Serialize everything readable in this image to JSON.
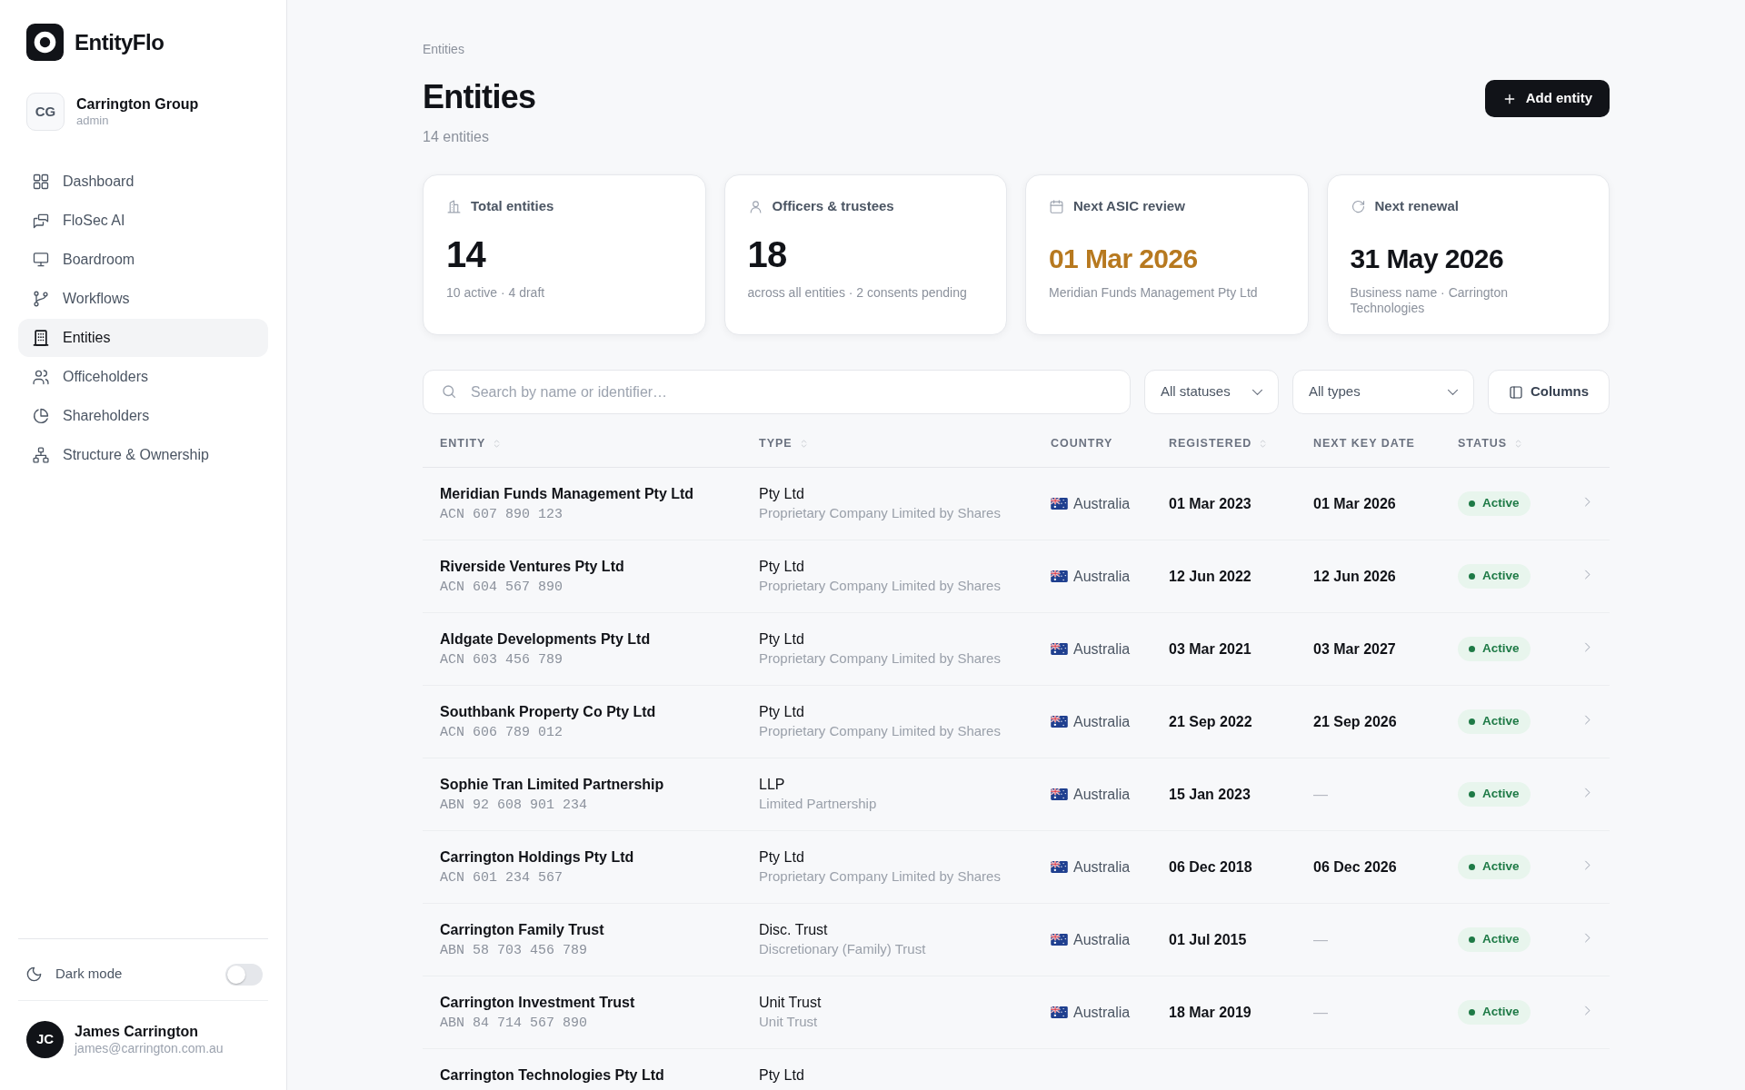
{
  "sidebar": {
    "brand": "EntityFlo",
    "organization": {
      "initials": "CG",
      "name": "Carrington Group",
      "role": "admin"
    },
    "nav": [
      {
        "label": "Dashboard",
        "selected": false
      },
      {
        "label": "FloSec AI",
        "selected": false
      },
      {
        "label": "Boardroom",
        "selected": false
      },
      {
        "label": "Workflows",
        "selected": false
      },
      {
        "label": "Entities",
        "selected": true
      },
      {
        "label": "Officeholders",
        "selected": false
      },
      {
        "label": "Shareholders",
        "selected": false
      },
      {
        "label": "Structure & Ownership",
        "selected": false
      }
    ],
    "dark_mode": {
      "label": "Dark mode",
      "on": false
    },
    "user": {
      "initials": "JC",
      "name": "James Carrington",
      "email": "james@carrington.com.au"
    }
  },
  "page": {
    "breadcrumb": "Entities",
    "title": "Entities",
    "subtitle": "14 entities",
    "add_button": "Add entity"
  },
  "stats": [
    {
      "label": "Total entities",
      "kind": "count",
      "value": "14",
      "warning": false,
      "note": "10 active · 4 draft"
    },
    {
      "label": "Officers & trustees",
      "kind": "count",
      "value": "18",
      "warning": false,
      "note": "across all entities · 2 consents pending"
    },
    {
      "label": "Next ASIC review",
      "kind": "date",
      "value": "01 Mar 2026",
      "warning": true,
      "note": "Meridian Funds Management Pty Ltd"
    },
    {
      "label": "Next renewal",
      "kind": "date",
      "value": "31 May 2026",
      "warning": false,
      "note": "Business name · Carrington Technologies"
    }
  ],
  "filters": {
    "search": {
      "placeholder": "Search by name or identifier…"
    },
    "status": "All statuses",
    "type": "All types",
    "columns_button": "Columns"
  },
  "table": {
    "columns": [
      {
        "label": "ENTITY",
        "sortable": true
      },
      {
        "label": "TYPE",
        "sortable": true
      },
      {
        "label": "COUNTRY",
        "sortable": false
      },
      {
        "label": "REGISTERED",
        "sortable": true
      },
      {
        "label": "NEXT KEY DATE",
        "sortable": false
      },
      {
        "label": "STATUS",
        "sortable": true
      }
    ],
    "rows": [
      {
        "name": "Meridian Funds Management Pty Ltd",
        "identifier": "ACN 607 890 123",
        "type": "Pty Ltd",
        "type_detail": "Proprietary Company Limited by Shares",
        "country": "Australia",
        "registered": "01 Mar 2023",
        "next_key_date": {
          "text": "01 Mar 2026",
          "muted": false
        },
        "status": "Active"
      },
      {
        "name": "Riverside Ventures Pty Ltd",
        "identifier": "ACN 604 567 890",
        "type": "Pty Ltd",
        "type_detail": "Proprietary Company Limited by Shares",
        "country": "Australia",
        "registered": "12 Jun 2022",
        "next_key_date": {
          "text": "12 Jun 2026",
          "muted": false
        },
        "status": "Active"
      },
      {
        "name": "Aldgate Developments Pty Ltd",
        "identifier": "ACN 603 456 789",
        "type": "Pty Ltd",
        "type_detail": "Proprietary Company Limited by Shares",
        "country": "Australia",
        "registered": "03 Mar 2021",
        "next_key_date": {
          "text": "03 Mar 2027",
          "muted": false
        },
        "status": "Active"
      },
      {
        "name": "Southbank Property Co Pty Ltd",
        "identifier": "ACN 606 789 012",
        "type": "Pty Ltd",
        "type_detail": "Proprietary Company Limited by Shares",
        "country": "Australia",
        "registered": "21 Sep 2022",
        "next_key_date": {
          "text": "21 Sep 2026",
          "muted": false
        },
        "status": "Active"
      },
      {
        "name": "Sophie Tran Limited Partnership",
        "identifier": "ABN 92 608 901 234",
        "type": "LLP",
        "type_detail": "Limited Partnership",
        "country": "Australia",
        "registered": "15 Jan 2023",
        "next_key_date": {
          "text": "—",
          "muted": true
        },
        "status": "Active"
      },
      {
        "name": "Carrington Holdings Pty Ltd",
        "identifier": "ACN 601 234 567",
        "type": "Pty Ltd",
        "type_detail": "Proprietary Company Limited by Shares",
        "country": "Australia",
        "registered": "06 Dec 2018",
        "next_key_date": {
          "text": "06 Dec 2026",
          "muted": false
        },
        "status": "Active"
      },
      {
        "name": "Carrington Family Trust",
        "identifier": "ABN 58 703 456 789",
        "type": "Disc. Trust",
        "type_detail": "Discretionary (Family) Trust",
        "country": "Australia",
        "registered": "01 Jul 2015",
        "next_key_date": {
          "text": "—",
          "muted": true
        },
        "status": "Active"
      },
      {
        "name": "Carrington Investment Trust",
        "identifier": "ABN 84 714 567 890",
        "type": "Unit Trust",
        "type_detail": "Unit Trust",
        "country": "Australia",
        "registered": "18 Mar 2019",
        "next_key_date": {
          "text": "—",
          "muted": true
        },
        "status": "Active"
      },
      {
        "name": "Carrington Technologies Pty Ltd",
        "type": "Pty Ltd"
      }
    ]
  }
}
